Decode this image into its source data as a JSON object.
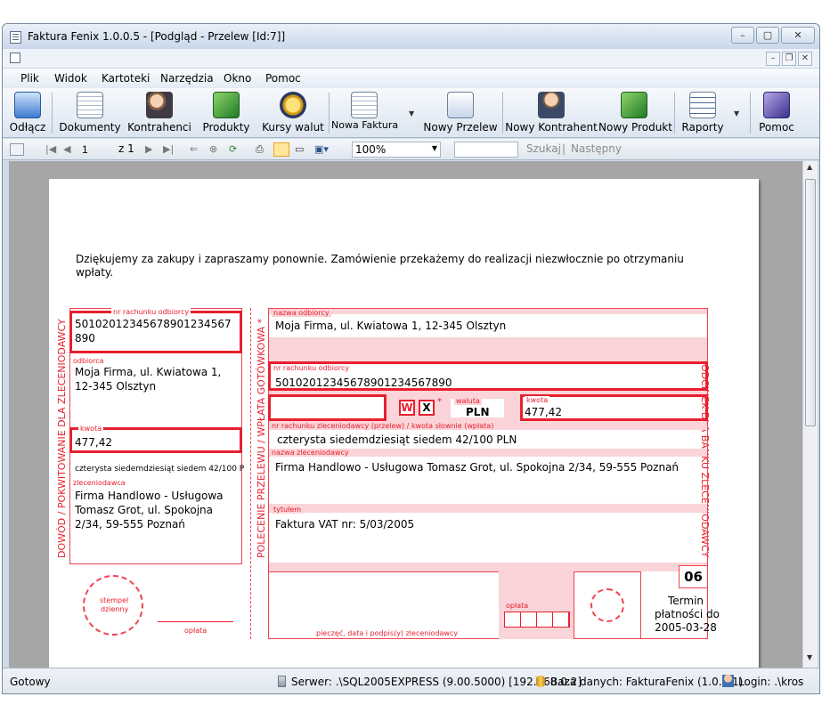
{
  "window": {
    "title": "Faktura Fenix 1.0.0.5 - [Podgląd - Przelew [Id:7]]",
    "min": "–",
    "max": "▢",
    "close": "✕"
  },
  "mdi": {
    "min": "–",
    "restore": "❐",
    "close": "✕"
  },
  "menu": [
    "Plik",
    "Widok",
    "Kartoteki",
    "Narzędzia",
    "Okno",
    "Pomoc"
  ],
  "toolbar": [
    {
      "label": "Odłącz",
      "icon": "disconnect-icon"
    },
    {
      "label": "Dokumenty",
      "icon": "documents-icon"
    },
    {
      "label": "Kontrahenci",
      "icon": "contractors-icon"
    },
    {
      "label": "Produkty",
      "icon": "products-icon"
    },
    {
      "label": "Kursy walut",
      "icon": "exchange-rates-icon"
    },
    {
      "label": "Nowa Faktura",
      "icon": "new-invoice-icon"
    },
    {
      "label": "Nowy Przelew",
      "icon": "new-transfer-icon"
    },
    {
      "label": "Nowy Kontrahent",
      "icon": "new-contractor-icon"
    },
    {
      "label": "Nowy Produkt",
      "icon": "new-product-icon"
    },
    {
      "label": "Raporty",
      "icon": "reports-icon"
    },
    {
      "label": "Pomoc",
      "icon": "help-icon"
    }
  ],
  "viewer": {
    "page": "1",
    "of": "z 1",
    "zoom": "100%",
    "search": "Szukaj",
    "sep": "|",
    "next": "Następny"
  },
  "doc": {
    "message": "Dziękujemy za zakupy i zapraszamy ponownie. Zamówienie przekażemy do realizacji niezwłocznie po otrzymaniu",
    "message2": "wpłaty.",
    "left_vertical": "DOWÓD / POKWITOWANIE DLA ZLECENIODAWCY",
    "mid_vertical": "POLECENIE PRZELEWU / WPŁATA GOTÓWKOWA *",
    "right_vertical": "ODCINEK DLA BANKU ZLECENIODAWCY",
    "lbl_account": "nr rachunku odbiorcy",
    "account_l1": "501020123456789012345​67",
    "account_l2": "890",
    "lbl_receiver": "odbiorca",
    "receiver_l1": "Moja Firma, ul. Kwiatowa 1,",
    "receiver_l2": "12-345 Olsztyn",
    "lbl_amount": "kwota",
    "amount": "477,42",
    "amount_words_small": "czterysta siedemdziesiąt siedem 42/100 P",
    "lbl_payer": "zleceniodawca",
    "payer_l1": "Firma Handlowo - Usługowa",
    "payer_l2": "Tomasz Grot, ul. Spokojna",
    "payer_l3": "2/34, 59-555 Poznań",
    "stamp": "stempel",
    "stamp2": "dzienny",
    "lbl_fee": "opłata",
    "lbl_recv_name": "nazwa odbiorcy",
    "recv_name": "Moja Firma, ul. Kwiatowa 1, 12-345 Olsztyn",
    "lbl_recv_acc": "nr rachunku odbiorcy",
    "recv_acc": "50102012345678901234567890",
    "w": "W",
    "x": "X",
    "star": "*",
    "lbl_currency": "waluta",
    "currency": "PLN",
    "lbl_amount2": "kwota",
    "amount2": "477,42",
    "lbl_acc_words": "nr rachunku zleceniodawcy (przelew) / kwota słownie (wpłata)",
    "amount_words": "czterysta siedemdziesiąt siedem 42/100 PLN",
    "lbl_payer_name": "nazwa zleceniodawcy",
    "payer_name": "Firma Handlowo - Usługowa Tomasz Grot, ul. Spokojna 2/34, 59-555 Poznań",
    "lbl_title": "tytułem",
    "title": "Faktura VAT nr: 5/03/2005",
    "code": "06",
    "lbl_signature": "pieczęć, data i podpis(y) zleceniodawcy",
    "lbl_fee2": "opłata",
    "due_l1": "Termin",
    "due_l2": "płatności do",
    "due_date": "2005-03-28"
  },
  "status": {
    "ready": "Gotowy",
    "server": "Serwer: .\\SQL2005EXPRESS (9.00.5000) [192.168.0.2]",
    "db": "Baza danych: FakturaFenix (1.0.0.1)",
    "login": "Login: .\\kros"
  }
}
